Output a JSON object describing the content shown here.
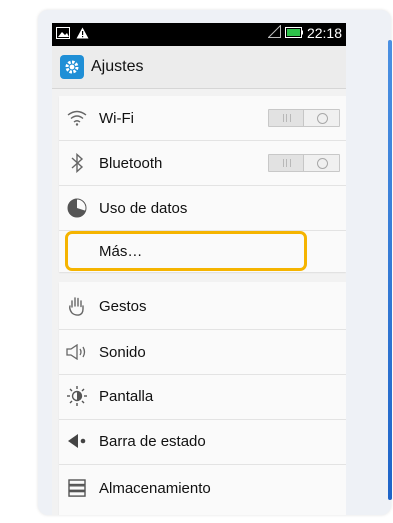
{
  "status_bar": {
    "time": "22:18",
    "icons": [
      "image-icon",
      "warning-icon",
      "signal-icon",
      "battery-icon"
    ]
  },
  "action_bar": {
    "title": "Ajustes",
    "icon": "settings-app-icon"
  },
  "sections": [
    {
      "items": [
        {
          "label": "Wi-Fi",
          "icon": "wifi-icon",
          "toggle": "off"
        },
        {
          "label": "Bluetooth",
          "icon": "bluetooth-icon",
          "toggle": "off"
        },
        {
          "label": "Uso de datos",
          "icon": "data-usage-icon"
        },
        {
          "label": "Más…",
          "highlighted": true
        }
      ]
    },
    {
      "items": [
        {
          "label": "Gestos",
          "icon": "hand-icon"
        },
        {
          "label": "Sonido",
          "icon": "speaker-icon"
        },
        {
          "label": "Pantalla",
          "icon": "brightness-icon"
        },
        {
          "label": "Barra de estado",
          "icon": "status-bar-icon"
        },
        {
          "label": "Almacenamiento",
          "icon": "storage-icon"
        }
      ]
    }
  ],
  "colors": {
    "highlight": "#f5b400",
    "app_icon": "#1f8fd6",
    "accent_bar": "#1e64c8"
  }
}
